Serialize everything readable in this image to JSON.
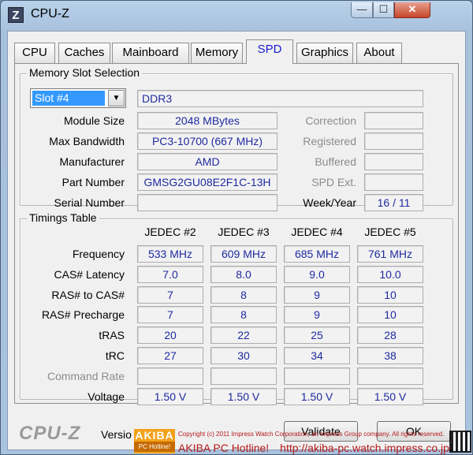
{
  "window": {
    "icon_letter": "Z",
    "title": "CPU-Z",
    "min": "—",
    "max": "☐",
    "close": "✕"
  },
  "tabs": [
    "CPU",
    "Caches",
    "Mainboard",
    "Memory",
    "SPD",
    "Graphics",
    "About"
  ],
  "active_tab": "SPD",
  "slot_group": {
    "title": "Memory Slot Selection",
    "slot_value": "Slot #4",
    "memory_type": "DDR3",
    "labels": {
      "module_size": "Module Size",
      "max_bandwidth": "Max Bandwidth",
      "manufacturer": "Manufacturer",
      "part_number": "Part Number",
      "serial_number": "Serial Number",
      "correction": "Correction",
      "registered": "Registered",
      "buffered": "Buffered",
      "spd_ext": "SPD Ext.",
      "week_year": "Week/Year"
    },
    "values": {
      "module_size": "2048 MBytes",
      "max_bandwidth": "PC3-10700 (667 MHz)",
      "manufacturer": "AMD",
      "part_number": "GMSG2GU08E2F1C-13H",
      "serial_number": "",
      "correction": "",
      "registered": "",
      "buffered": "",
      "spd_ext": "",
      "week_year": "16 / 11"
    }
  },
  "timings": {
    "title": "Timings Table",
    "columns": [
      "JEDEC #2",
      "JEDEC #3",
      "JEDEC #4",
      "JEDEC #5"
    ],
    "rows": [
      {
        "label": "Frequency",
        "values": [
          "533 MHz",
          "609 MHz",
          "685 MHz",
          "761 MHz"
        ],
        "dim": false
      },
      {
        "label": "CAS# Latency",
        "values": [
          "7.0",
          "8.0",
          "9.0",
          "10.0"
        ],
        "dim": false
      },
      {
        "label": "RAS# to CAS#",
        "values": [
          "7",
          "8",
          "9",
          "10"
        ],
        "dim": false
      },
      {
        "label": "RAS# Precharge",
        "values": [
          "7",
          "8",
          "9",
          "10"
        ],
        "dim": false
      },
      {
        "label": "tRAS",
        "values": [
          "20",
          "22",
          "25",
          "28"
        ],
        "dim": false
      },
      {
        "label": "tRC",
        "values": [
          "27",
          "30",
          "34",
          "38"
        ],
        "dim": false
      },
      {
        "label": "Command Rate",
        "values": [
          "",
          "",
          "",
          ""
        ],
        "dim": true
      },
      {
        "label": "Voltage",
        "values": [
          "1.50 V",
          "1.50 V",
          "1.50 V",
          "1.50 V"
        ],
        "dim": false
      }
    ]
  },
  "footer": {
    "brand": "CPU-Z",
    "version": "Versio",
    "validate": "Validate",
    "ok": "OK"
  },
  "watermark": {
    "logo_top": "AKIBA",
    "logo_bottom": "PC Hotline!",
    "copyright": "Copyright (c) 2011 Impress Watch Corporation, an Impress Group company. All rights reserved.",
    "site": "AKIBA PC Hotline!　http://akiba-pc.watch.impress.co.jp/"
  },
  "colors": {
    "value_text": "#1e2aa0",
    "active_tab_text": "#1a1ad0",
    "select_highlight": "#3399ff"
  }
}
